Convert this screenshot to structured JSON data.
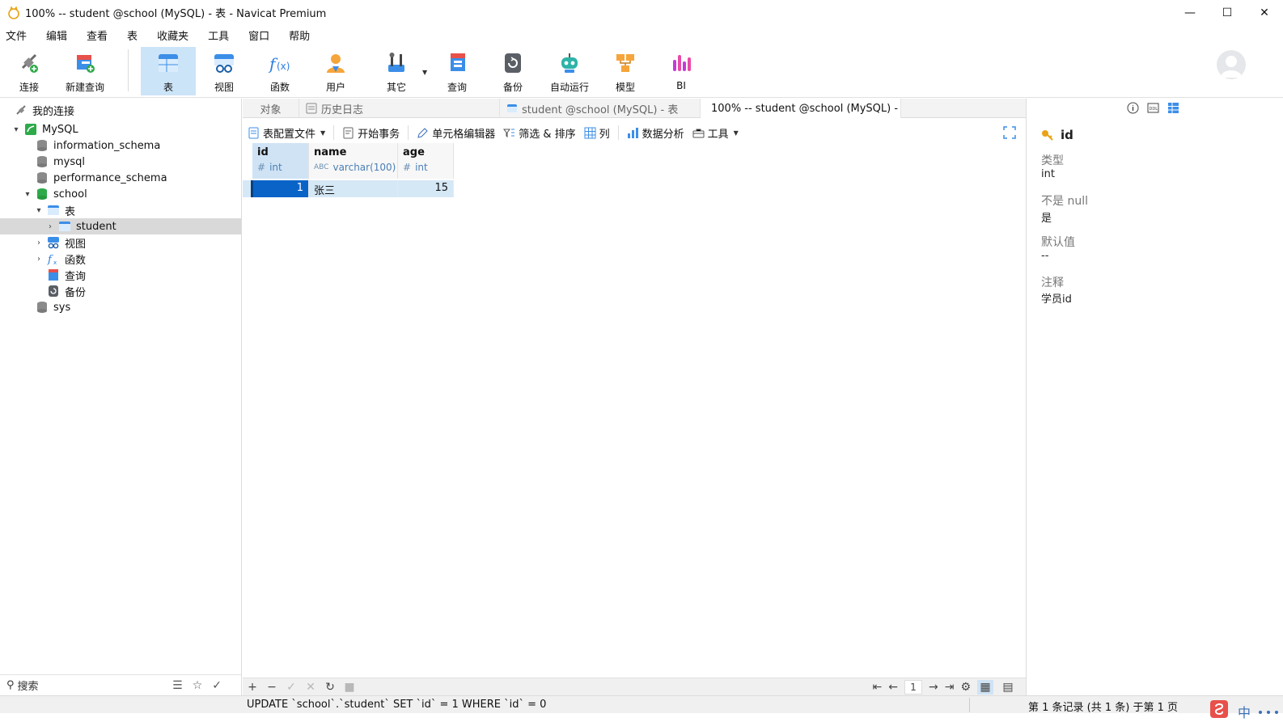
{
  "window": {
    "title": "100% -- student @school (MySQL) - 表 - Navicat Premium",
    "controls": [
      "minimize",
      "maximize",
      "close"
    ]
  },
  "menu": [
    "文件",
    "编辑",
    "查看",
    "表",
    "收藏夹",
    "工具",
    "窗口",
    "帮助"
  ],
  "ribbon": {
    "items": [
      {
        "label": "连接",
        "icon": "plug-connect-icon"
      },
      {
        "label": "新建查询",
        "icon": "new-query-icon"
      },
      {
        "label": "表",
        "icon": "table-icon",
        "active": true
      },
      {
        "label": "视图",
        "icon": "view-glasses-icon"
      },
      {
        "label": "函数",
        "icon": "function-icon"
      },
      {
        "label": "用户",
        "icon": "user-icon"
      },
      {
        "label": "其它",
        "icon": "tools-icon"
      },
      {
        "label": "查询",
        "icon": "query-icon"
      },
      {
        "label": "备份",
        "icon": "backup-icon"
      },
      {
        "label": "自动运行",
        "icon": "robot-icon"
      },
      {
        "label": "模型",
        "icon": "model-icon"
      },
      {
        "label": "BI",
        "icon": "bi-chart-icon"
      }
    ]
  },
  "nav": {
    "header": "我的连接",
    "tree": [
      {
        "label": "MySQL",
        "icon": "mysql-connection-icon",
        "expanded": true
      },
      {
        "label": "information_schema",
        "icon": "database-icon"
      },
      {
        "label": "mysql",
        "icon": "database-icon"
      },
      {
        "label": "performance_schema",
        "icon": "database-icon"
      },
      {
        "label": "school",
        "icon": "database-open-icon",
        "expanded": true
      },
      {
        "label": "表",
        "icon": "table-icon",
        "expanded": true
      },
      {
        "label": "student",
        "icon": "table-icon",
        "selected": true
      },
      {
        "label": "视图",
        "icon": "view-glasses-icon"
      },
      {
        "label": "函数",
        "icon": "function-icon"
      },
      {
        "label": "查询",
        "icon": "query-icon"
      },
      {
        "label": "备份",
        "icon": "backup-icon"
      },
      {
        "label": "sys",
        "icon": "database-icon"
      }
    ],
    "search_placeholder": "搜索"
  },
  "tabs": [
    {
      "label": "对象"
    },
    {
      "label": "历史日志"
    },
    {
      "label": "student @school (MySQL) - 表"
    },
    {
      "label": "100% -- student @school (MySQL) - ...",
      "active": true
    }
  ],
  "subtoolbar": {
    "items": [
      "表配置文件",
      "开始事务",
      "单元格编辑器",
      "筛选 & 排序",
      "列",
      "数据分析",
      "工具"
    ]
  },
  "grid": {
    "columns": [
      {
        "name": "id",
        "type": "int",
        "type_icon": "#"
      },
      {
        "name": "name",
        "type": "varchar(100)",
        "type_icon": "ABC"
      },
      {
        "name": "age",
        "type": "int",
        "type_icon": "#"
      }
    ],
    "rows": [
      {
        "id": "1",
        "name": "张三",
        "age": "15"
      }
    ]
  },
  "pager": {
    "page": "1"
  },
  "info": {
    "field": "id",
    "props": [
      {
        "label": "类型",
        "value": "int"
      },
      {
        "label": "不是 null",
        "value": "是"
      },
      {
        "label": "默认值",
        "value": "--"
      },
      {
        "label": "注释",
        "value": "学员id"
      }
    ]
  },
  "status": {
    "sql": "UPDATE `school`.`student` SET `id` = 1 WHERE `id` = 0",
    "records": "第 1 条记录 (共 1 条) 于第 1 页"
  },
  "colors": {
    "accent": "#0a64c8",
    "selection": "#cce4f7"
  }
}
